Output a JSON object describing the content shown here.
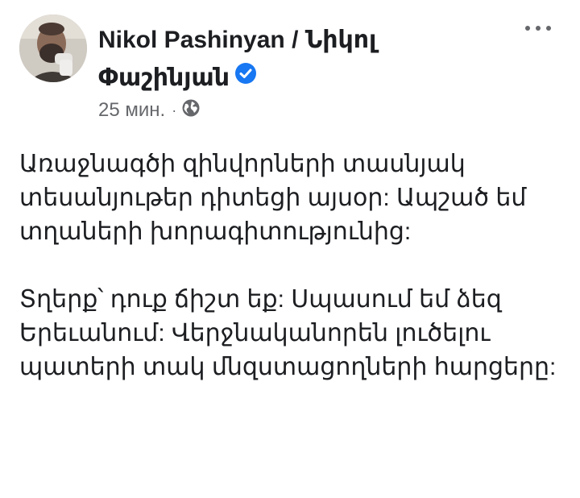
{
  "post": {
    "author": "Nikol Pashinyan / Նիկոլ Փաշինյան",
    "verified_icon": "verified-badge-icon",
    "timestamp": "25 мин.",
    "separator": "·",
    "audience_icon": "globe-icon",
    "more_icon": "more-options-icon",
    "paragraphs": [
      "Առաջնագծի զինվորների տասնյակ տեսանյութեր դիտեցի այսօր: Ապշած եմ տղաների խորագիտությունից:",
      "Տղերք՝ դուք ճիշտ եք: Սպասում եմ ձեզ Երեւանում: Վերջնականորեն լուծելու պատերի տակ մնզստացողների հարցերը:"
    ]
  },
  "colors": {
    "text": "#1c1e21",
    "secondary": "#65676b",
    "verified": "#1877f2",
    "background": "#ffffff"
  }
}
